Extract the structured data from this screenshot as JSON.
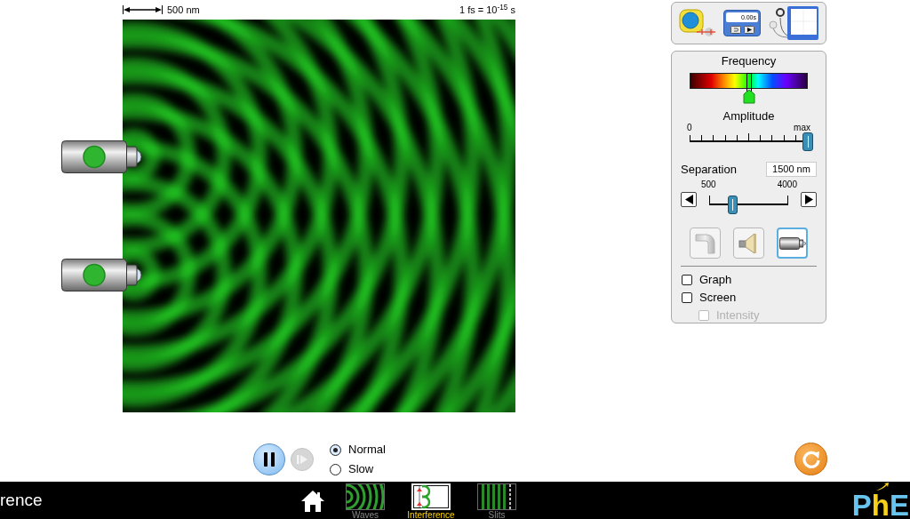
{
  "scale_bar": {
    "label": "500 nm"
  },
  "time_scale": "1 fs = 10$^{-15}$ s",
  "tools": [
    {
      "kind": "measuring_tape"
    },
    {
      "kind": "stopwatch",
      "reading": "0.00s"
    },
    {
      "kind": "wave_meter"
    }
  ],
  "frequency": {
    "label": "Frequency",
    "level": 0.5
  },
  "amplitude": {
    "label": "Amplitude",
    "min_label": "0",
    "max_label": "max",
    "level": 1
  },
  "separation": {
    "label": "Separation",
    "value": "1500 nm",
    "min_label": "500",
    "max_label": "4000",
    "level": 0.29
  },
  "scenes": [
    {
      "kind": "water",
      "selected": false
    },
    {
      "kind": "sound",
      "selected": false
    },
    {
      "kind": "light",
      "selected": true
    }
  ],
  "checkboxes": [
    {
      "label": "Graph",
      "checked": false,
      "disabled": false
    },
    {
      "label": "Screen",
      "checked": false,
      "disabled": false,
      "children": [
        {
          "label": "Intensity",
          "checked": false,
          "disabled": true
        }
      ]
    }
  ],
  "play_pause": {
    "playing": true
  },
  "step": {
    "disabled": true
  },
  "speed": [
    {
      "label": "Normal",
      "selected": true
    },
    {
      "label": "Slow",
      "selected": false
    }
  ],
  "navbar": {
    "title": "rence",
    "screens": [
      {
        "kind": "waves",
        "label": "Waves",
        "selected": false
      },
      {
        "kind": "interference",
        "label": "Interference",
        "selected": true
      },
      {
        "kind": "slits",
        "label": "Slits",
        "selected": false
      }
    ],
    "logo": "PhE"
  }
}
